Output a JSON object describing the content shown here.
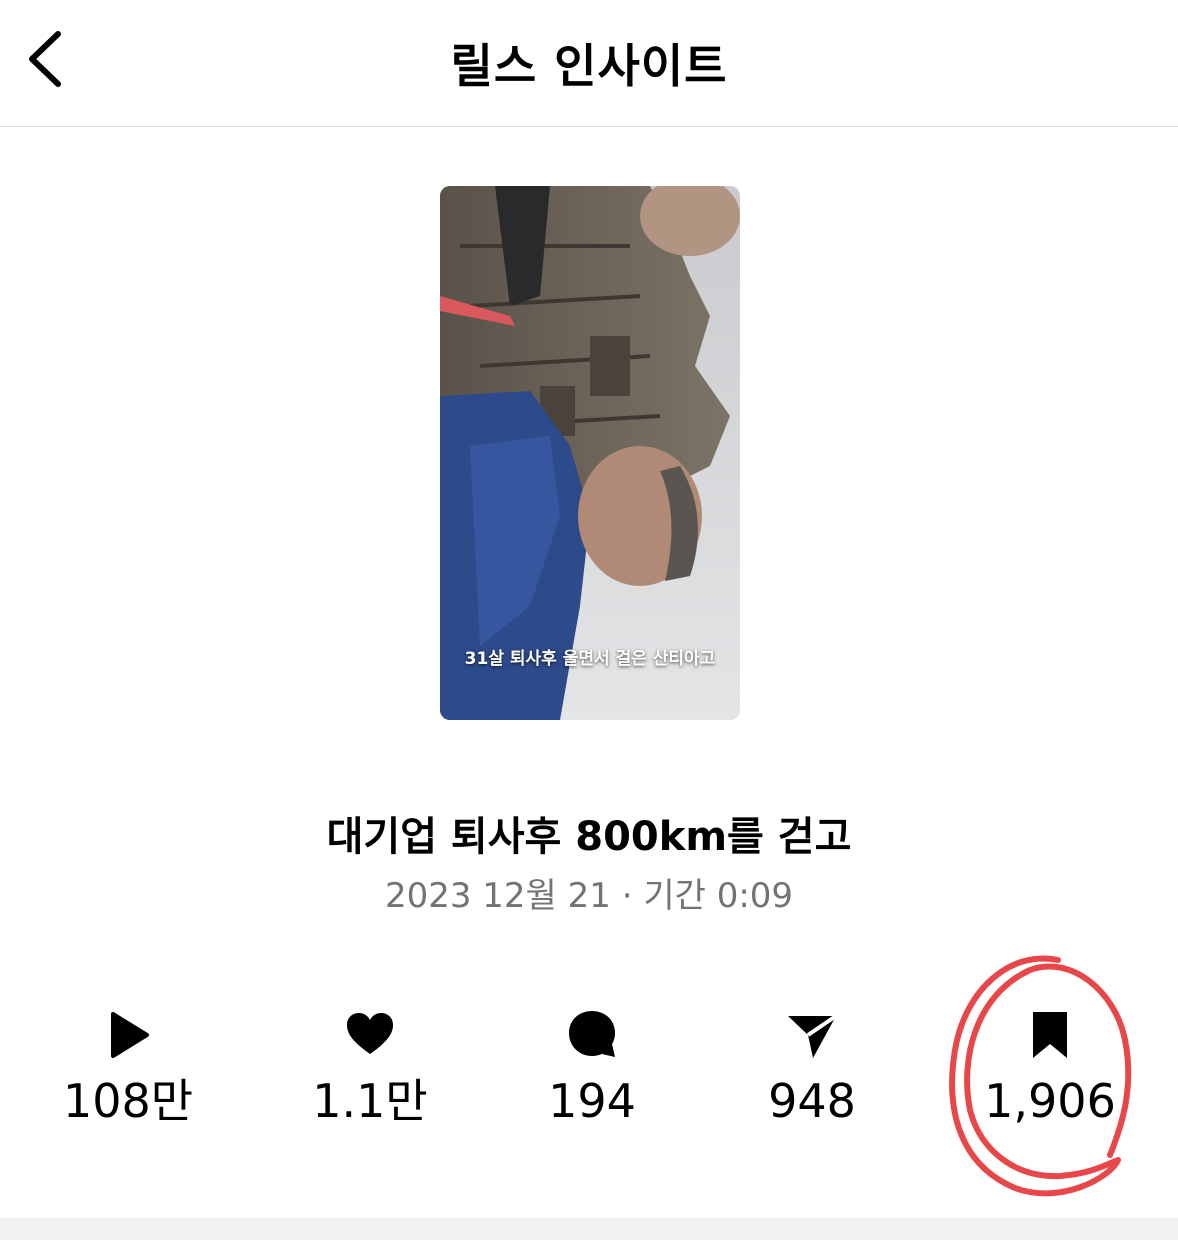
{
  "header": {
    "title": "릴스 인사이트",
    "back_icon": "chevron-left-icon"
  },
  "reel": {
    "thumbnail_caption": "31살 퇴사후 울면서 걸은 산티아고",
    "title": "대기업 퇴사후 800km를 걷고",
    "meta": "2023 12월 21 · 기간 0:09"
  },
  "stats": [
    {
      "icon": "play-icon",
      "value": "108만"
    },
    {
      "icon": "heart-icon",
      "value": "1.1만"
    },
    {
      "icon": "comment-icon",
      "value": "194"
    },
    {
      "icon": "share-icon",
      "value": "948"
    },
    {
      "icon": "bookmark-icon",
      "value": "1,906"
    }
  ],
  "colors": {
    "annotation_circle": "#e8474a",
    "meta_text": "#737373"
  }
}
